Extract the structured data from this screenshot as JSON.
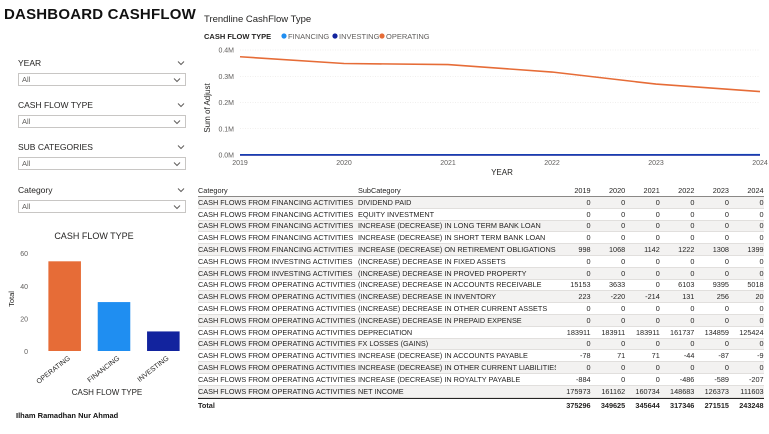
{
  "title": "DASHBOARD CASHFLOW",
  "author": "Ilham Ramadhan Nur Ahmad",
  "slicers": [
    {
      "label": "YEAR",
      "value": "All"
    },
    {
      "label": "CASH FLOW TYPE",
      "value": "All"
    },
    {
      "label": "SUB CATEGORIES",
      "value": "All"
    },
    {
      "label": "Category",
      "value": "All"
    }
  ],
  "colors": {
    "financing": "#1f8ef1",
    "investing": "#12239e",
    "operating": "#e66c37"
  },
  "bar_chart": {
    "title": "CASH FLOW TYPE",
    "xlabel": "CASH FLOW TYPE",
    "ylabel": "Total",
    "yticks": [
      "0",
      "20",
      "40",
      "60"
    ]
  },
  "line_chart": {
    "title": "Trendline CashFlow Type",
    "legend_title": "CASH FLOW TYPE",
    "xlabel": "YEAR",
    "ylabel": "Sum of Adjust",
    "yticks": [
      "0.0M",
      "0.1M",
      "0.2M",
      "0.3M",
      "0.4M"
    ],
    "xticks": [
      "2019",
      "2020",
      "2021",
      "2022",
      "2023",
      "2024"
    ]
  },
  "chart_data": [
    {
      "type": "bar",
      "title": "CASH FLOW TYPE",
      "xlabel": "CASH FLOW TYPE",
      "ylabel": "Total",
      "categories": [
        "OPERATING",
        "FINANCING",
        "INVESTING"
      ],
      "values": [
        55,
        30,
        12
      ],
      "colors": [
        "#e66c37",
        "#1f8ef1",
        "#12239e"
      ],
      "ylim": [
        0,
        65
      ]
    },
    {
      "type": "line",
      "title": "Trendline CashFlow Type",
      "xlabel": "YEAR",
      "ylabel": "Sum of Adjust",
      "x": [
        2019,
        2020,
        2021,
        2022,
        2023,
        2024
      ],
      "series": [
        {
          "name": "FINANCING",
          "color": "#1f8ef1",
          "values": [
            998,
            1068,
            1142,
            1222,
            1308,
            1399
          ]
        },
        {
          "name": "INVESTING",
          "color": "#12239e",
          "values": [
            0,
            0,
            0,
            0,
            0,
            0
          ]
        },
        {
          "name": "OPERATING",
          "color": "#e66c37",
          "values": [
            374298,
            348557,
            344502,
            316124,
            270207,
            241849
          ]
        }
      ],
      "ylim": [
        0,
        400000
      ],
      "legend": "top-left"
    }
  ],
  "table": {
    "headers": [
      "Category",
      "SubCategory",
      "2019",
      "2020",
      "2021",
      "2022",
      "2023",
      "2024"
    ],
    "rows": [
      [
        "CASH FLOWS FROM FINANCING ACTIVITIES",
        "DIVIDEND PAID",
        "0",
        "0",
        "0",
        "0",
        "0",
        "0"
      ],
      [
        "CASH FLOWS FROM FINANCING ACTIVITIES",
        "EQUITY INVESTMENT",
        "0",
        "0",
        "0",
        "0",
        "0",
        "0"
      ],
      [
        "CASH FLOWS FROM FINANCING ACTIVITIES",
        "INCREASE (DECREASE) IN LONG TERM BANK LOAN",
        "0",
        "0",
        "0",
        "0",
        "0",
        "0"
      ],
      [
        "CASH FLOWS FROM FINANCING ACTIVITIES",
        "INCREASE (DECREASE) IN SHORT TERM BANK LOAN",
        "0",
        "0",
        "0",
        "0",
        "0",
        "0"
      ],
      [
        "CASH FLOWS FROM FINANCING ACTIVITIES",
        "INCREASE (DECREASE) ON RETIREMENT OBLIGATIONS",
        "998",
        "1068",
        "1142",
        "1222",
        "1308",
        "1399"
      ],
      [
        "CASH FLOWS FROM INVESTING ACTIVITIES",
        "(INCREASE) DECREASE IN FIXED ASSETS",
        "0",
        "0",
        "0",
        "0",
        "0",
        "0"
      ],
      [
        "CASH FLOWS FROM INVESTING ACTIVITIES",
        "(INCREASE) DECREASE IN PROVED PROPERTY",
        "0",
        "0",
        "0",
        "0",
        "0",
        "0"
      ],
      [
        "CASH FLOWS FROM OPERATING ACTIVITIES",
        "(INCREASE) DECREASE IN ACCOUNTS RECEIVABLE",
        "15153",
        "3633",
        "0",
        "6103",
        "9395",
        "5018"
      ],
      [
        "CASH FLOWS FROM OPERATING ACTIVITIES",
        "(INCREASE) DECREASE IN INVENTORY",
        "223",
        "-220",
        "-214",
        "131",
        "256",
        "20"
      ],
      [
        "CASH FLOWS FROM OPERATING ACTIVITIES",
        "(INCREASE) DECREASE IN OTHER CURRENT ASSETS",
        "0",
        "0",
        "0",
        "0",
        "0",
        "0"
      ],
      [
        "CASH FLOWS FROM OPERATING ACTIVITIES",
        "(INCREASE) DECREASE IN PREPAID EXPENSE",
        "0",
        "0",
        "0",
        "0",
        "0",
        "0"
      ],
      [
        "CASH FLOWS FROM OPERATING ACTIVITIES",
        "DEPRECIATION",
        "183911",
        "183911",
        "183911",
        "161737",
        "134859",
        "125424"
      ],
      [
        "CASH FLOWS FROM OPERATING ACTIVITIES",
        "FX LOSSES (GAINS)",
        "0",
        "0",
        "0",
        "0",
        "0",
        "0"
      ],
      [
        "CASH FLOWS FROM OPERATING ACTIVITIES",
        "INCREASE (DECREASE) IN ACCOUNTS PAYABLE",
        "-78",
        "71",
        "71",
        "-44",
        "-87",
        "-9"
      ],
      [
        "CASH FLOWS FROM OPERATING ACTIVITIES",
        "INCREASE (DECREASE) IN OTHER CURRENT LIABILITIES",
        "0",
        "0",
        "0",
        "0",
        "0",
        "0"
      ],
      [
        "CASH FLOWS FROM OPERATING ACTIVITIES",
        "INCREASE (DECREASE) IN ROYALTY PAYABLE",
        "-884",
        "0",
        "0",
        "-486",
        "-589",
        "-207"
      ],
      [
        "CASH FLOWS FROM OPERATING ACTIVITIES",
        "NET INCOME",
        "175973",
        "161162",
        "160734",
        "148683",
        "126373",
        "111603"
      ]
    ],
    "total_label": "Total",
    "totals": [
      "375296",
      "349625",
      "345644",
      "317346",
      "271515",
      "243248"
    ]
  }
}
